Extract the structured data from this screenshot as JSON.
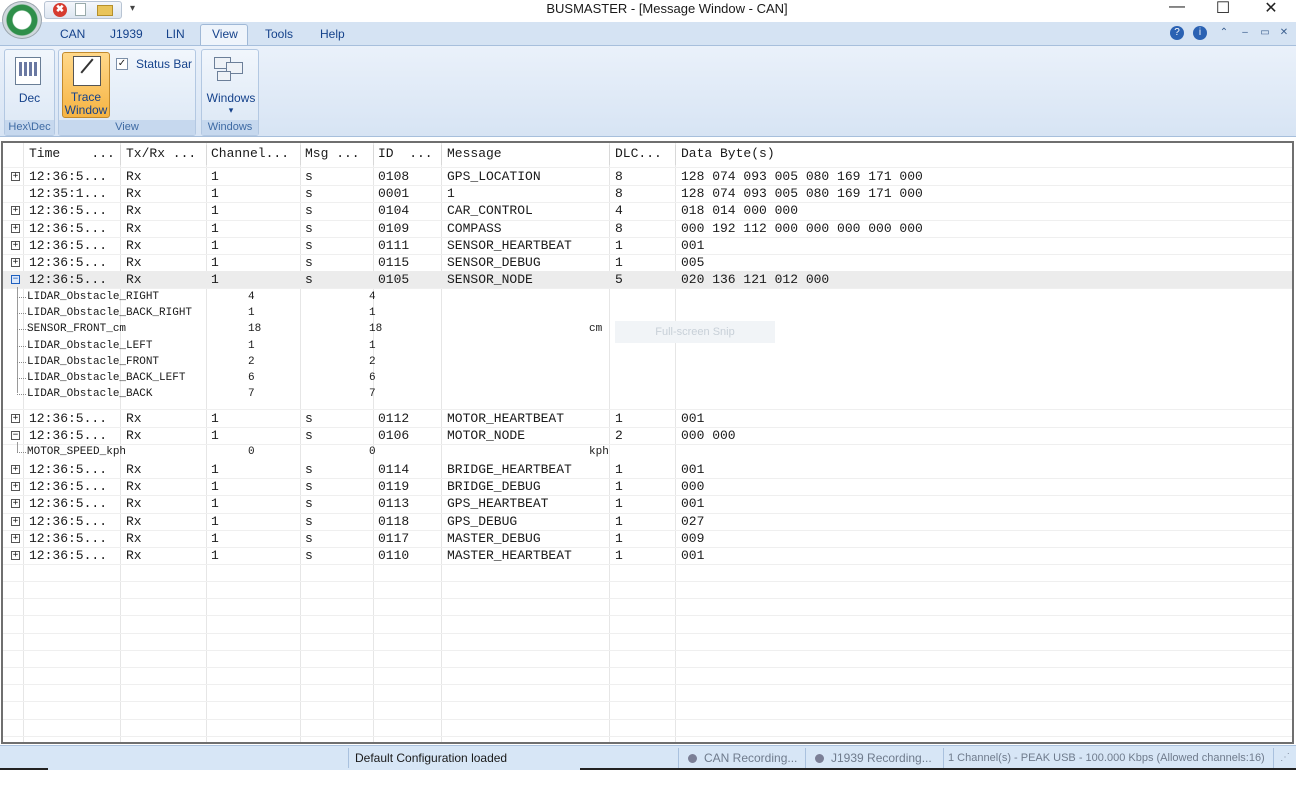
{
  "window": {
    "title": "BUSMASTER - [Message Window - CAN]",
    "minimize": "—",
    "maximize": "☐",
    "close": "✕"
  },
  "quick_access": {
    "close_icon": "✖",
    "dropdown": "▾"
  },
  "ribbon": {
    "tabs": [
      "CAN",
      "J1939",
      "LIN",
      "View",
      "Tools",
      "Help"
    ],
    "active_tab": "View",
    "right_icons": [
      "?",
      "i",
      "⌃",
      "–",
      "▭",
      "✕"
    ],
    "groups": {
      "hexdec": {
        "label": "Hex\\Dec",
        "button": "Dec"
      },
      "view": {
        "label": "View",
        "trace_button": [
          "Trace",
          "Window"
        ],
        "status_bar_check": "Status Bar",
        "status_bar_checked": true
      },
      "windows": {
        "label": "Windows",
        "button": "Windows",
        "arrow": "▾"
      }
    }
  },
  "message_list": {
    "columns": [
      "Time    ...",
      "Tx/Rx ...",
      "Channel...",
      "Msg ...",
      "ID  ...",
      "Message",
      "DLC...",
      "Data Byte(s)"
    ],
    "rows_top": [
      {
        "expander": "+",
        "time": "12:36:5...",
        "dir": "Rx",
        "channel": "1",
        "type": "s",
        "id": "0108",
        "message": "GPS_LOCATION",
        "dlc": "8",
        "data": "128 074 093 005 080 169 171 000"
      },
      {
        "expander": "",
        "time": "12:35:1...",
        "dir": "Rx",
        "channel": "1",
        "type": "s",
        "id": "0001",
        "message": "1",
        "dlc": "8",
        "data": "128 074 093 005 080 169 171 000"
      },
      {
        "expander": "+",
        "time": "12:36:5...",
        "dir": "Rx",
        "channel": "1",
        "type": "s",
        "id": "0104",
        "message": "CAR_CONTROL",
        "dlc": "4",
        "data": "018 014 000 000"
      },
      {
        "expander": "+",
        "time": "12:36:5...",
        "dir": "Rx",
        "channel": "1",
        "type": "s",
        "id": "0109",
        "message": "COMPASS",
        "dlc": "8",
        "data": "000 192 112 000 000 000 000 000"
      },
      {
        "expander": "+",
        "time": "12:36:5...",
        "dir": "Rx",
        "channel": "1",
        "type": "s",
        "id": "0111",
        "message": "SENSOR_HEARTBEAT",
        "dlc": "1",
        "data": "001"
      },
      {
        "expander": "+",
        "time": "12:36:5...",
        "dir": "Rx",
        "channel": "1",
        "type": "s",
        "id": "0115",
        "message": "SENSOR_DEBUG",
        "dlc": "1",
        "data": "005"
      },
      {
        "expander": "−",
        "time": "12:36:5...",
        "dir": "Rx",
        "channel": "1",
        "type": "s",
        "id": "0105",
        "message": "SENSOR_NODE",
        "dlc": "5",
        "data": "020 136 121 012 000"
      }
    ],
    "sensor_signals": [
      {
        "name": "LIDAR_Obstacle_RIGHT",
        "raw": "4",
        "phys": "4",
        "unit": ""
      },
      {
        "name": "LIDAR_Obstacle_BACK_RIGHT",
        "raw": "1",
        "phys": "1",
        "unit": ""
      },
      {
        "name": "SENSOR_FRONT_cm",
        "raw": "18",
        "phys": "18",
        "unit": "cm"
      },
      {
        "name": "LIDAR_Obstacle_LEFT",
        "raw": "1",
        "phys": "1",
        "unit": ""
      },
      {
        "name": "LIDAR_Obstacle_FRONT",
        "raw": "2",
        "phys": "2",
        "unit": ""
      },
      {
        "name": "LIDAR_Obstacle_BACK_LEFT",
        "raw": "6",
        "phys": "6",
        "unit": ""
      },
      {
        "name": "LIDAR_Obstacle_BACK",
        "raw": "7",
        "phys": "7",
        "unit": ""
      }
    ],
    "ghost_text": "Full-screen Snip",
    "rows_mid": [
      {
        "expander": "+",
        "time": "12:36:5...",
        "dir": "Rx",
        "channel": "1",
        "type": "s",
        "id": "0112",
        "message": "MOTOR_HEARTBEAT",
        "dlc": "1",
        "data": "001"
      },
      {
        "expander": "−",
        "time": "12:36:5...",
        "dir": "Rx",
        "channel": "1",
        "type": "s",
        "id": "0106",
        "message": "MOTOR_NODE",
        "dlc": "2",
        "data": "000 000"
      }
    ],
    "motor_signals": [
      {
        "name": "MOTOR_SPEED_kph",
        "raw": "0",
        "phys": "0",
        "unit": "kph"
      }
    ],
    "rows_bottom": [
      {
        "expander": "+",
        "time": "12:36:5...",
        "dir": "Rx",
        "channel": "1",
        "type": "s",
        "id": "0114",
        "message": "BRIDGE_HEARTBEAT",
        "dlc": "1",
        "data": "001"
      },
      {
        "expander": "+",
        "time": "12:36:5...",
        "dir": "Rx",
        "channel": "1",
        "type": "s",
        "id": "0119",
        "message": "BRIDGE_DEBUG",
        "dlc": "1",
        "data": "000"
      },
      {
        "expander": "+",
        "time": "12:36:5...",
        "dir": "Rx",
        "channel": "1",
        "type": "s",
        "id": "0113",
        "message": "GPS_HEARTBEAT",
        "dlc": "1",
        "data": "001"
      },
      {
        "expander": "+",
        "time": "12:36:5...",
        "dir": "Rx",
        "channel": "1",
        "type": "s",
        "id": "0118",
        "message": "GPS_DEBUG",
        "dlc": "1",
        "data": "027"
      },
      {
        "expander": "+",
        "time": "12:36:5...",
        "dir": "Rx",
        "channel": "1",
        "type": "s",
        "id": "0117",
        "message": "MASTER_DEBUG",
        "dlc": "1",
        "data": "009"
      },
      {
        "expander": "+",
        "time": "12:36:5...",
        "dir": "Rx",
        "channel": "1",
        "type": "s",
        "id": "0110",
        "message": "MASTER_HEARTBEAT",
        "dlc": "1",
        "data": "001"
      }
    ]
  },
  "status_bar": {
    "config": "Default Configuration loaded",
    "can_recording": "CAN Recording...",
    "j1939_recording": "J1939 Recording...",
    "channel_info": "1 Channel(s) - PEAK USB - 100.000 Kbps (Allowed channels:16)"
  },
  "colors": {
    "ribbon_bg": "#d5e3f3",
    "accent": "#15428b",
    "trace_button": "#f6b443",
    "status_bar_bg": "#d7e6f6"
  }
}
